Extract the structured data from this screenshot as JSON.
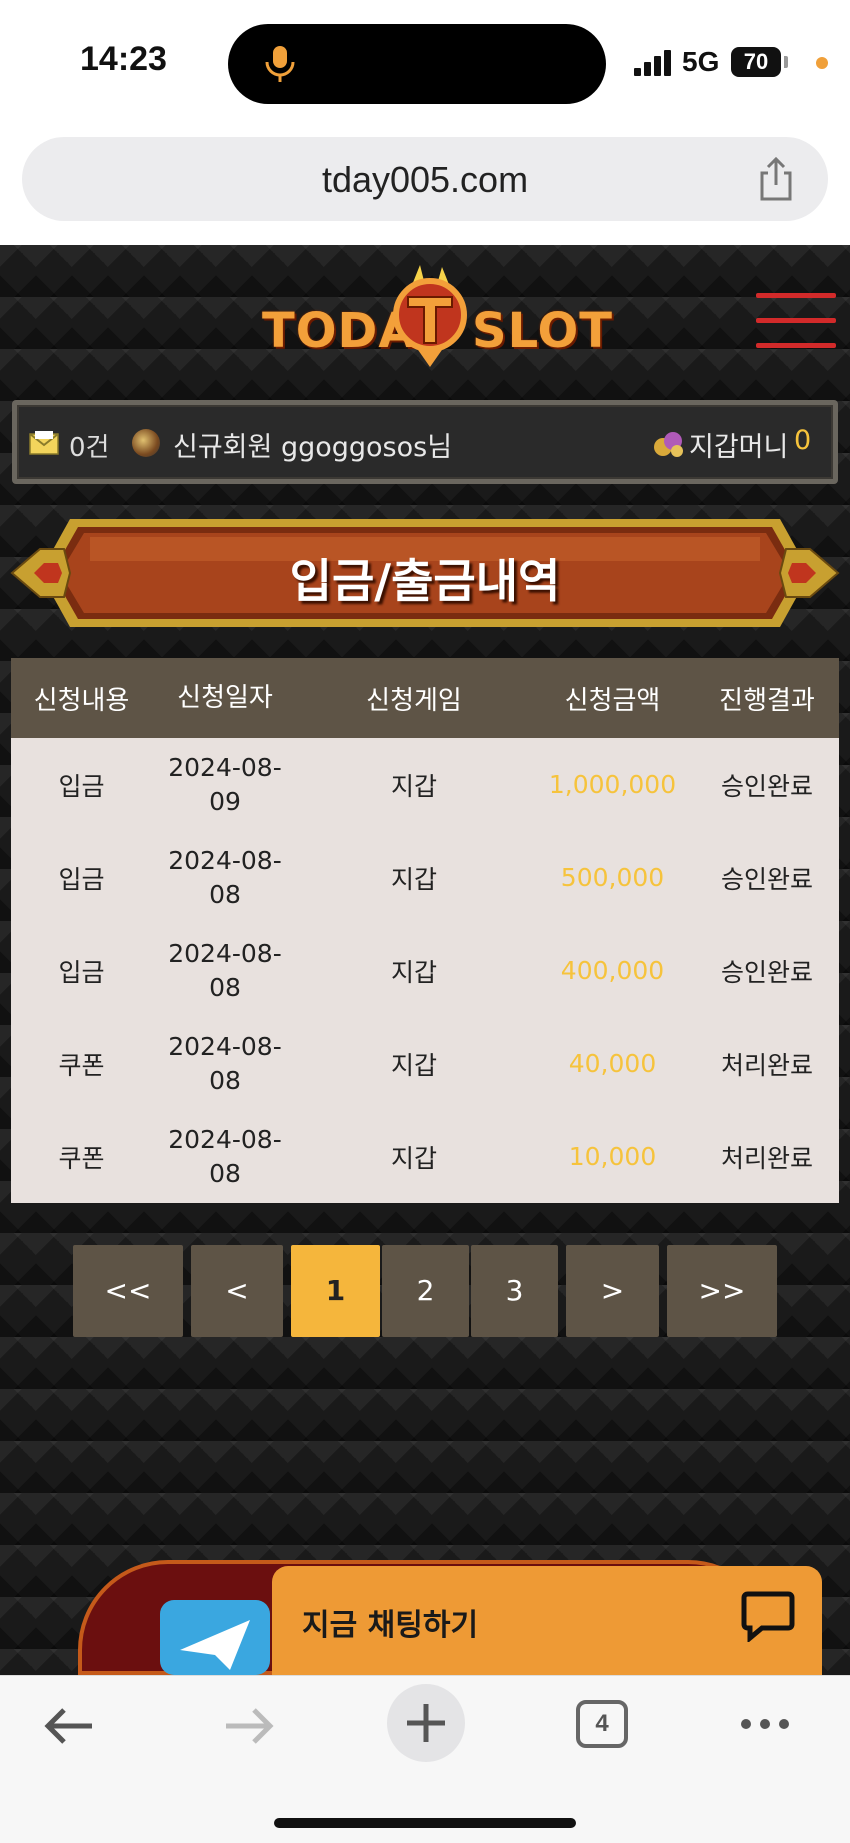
{
  "status_bar": {
    "time": "14:23",
    "network": "5G",
    "battery": "70"
  },
  "browser": {
    "url": "tday005.com",
    "tab_count": "4"
  },
  "site": {
    "logo": {
      "left": "TODAY",
      "right": "SLOT"
    },
    "member_bar": {
      "message_count": "0건",
      "member_prefix": "신규회원",
      "member_name": "ggoggosos",
      "member_suffix": "님",
      "wallet_label": "지갑머니",
      "wallet_value": "0"
    },
    "title": "입금/출금내역",
    "table": {
      "headers": [
        "신청내용",
        "신청일자",
        "신청게임",
        "신청금액",
        "진행결과"
      ],
      "rows": [
        {
          "type": "입금",
          "date_a": "2024-08-",
          "date_b": "09",
          "game": "지갑",
          "amount": "1,000,000",
          "result": "승인완료"
        },
        {
          "type": "입금",
          "date_a": "2024-08-",
          "date_b": "08",
          "game": "지갑",
          "amount": "500,000",
          "result": "승인완료"
        },
        {
          "type": "입금",
          "date_a": "2024-08-",
          "date_b": "08",
          "game": "지갑",
          "amount": "400,000",
          "result": "승인완료"
        },
        {
          "type": "쿠폰",
          "date_a": "2024-08-",
          "date_b": "08",
          "game": "지갑",
          "amount": "40,000",
          "result": "처리완료"
        },
        {
          "type": "쿠폰",
          "date_a": "2024-08-",
          "date_b": "08",
          "game": "지갑",
          "amount": "10,000",
          "result": "처리완료"
        }
      ]
    },
    "pagination": {
      "first": "<<",
      "prev": "<",
      "pages": [
        "1",
        "2",
        "3"
      ],
      "current": "1",
      "next": ">",
      "last": ">>"
    },
    "chat": {
      "label": "지금 채팅하기"
    }
  },
  "colors": {
    "accent": "#f5b63c",
    "amount": "#f6c33c",
    "header_bg": "#5e5446",
    "chat_bg": "#ee9a35"
  }
}
